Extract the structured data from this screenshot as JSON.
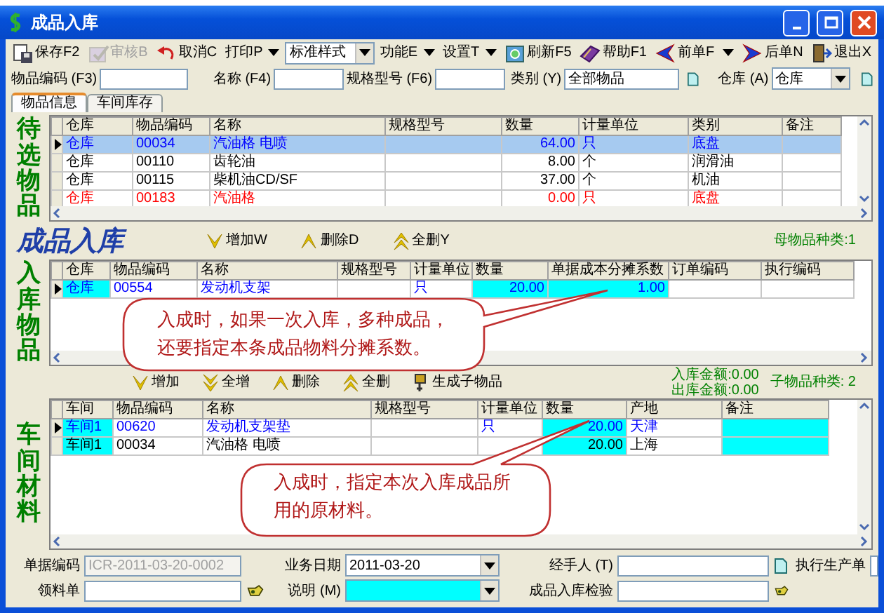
{
  "window": {
    "title": "成品入库"
  },
  "toolbar": [
    {
      "kind": "button",
      "label": "保存F2",
      "disabled": false
    },
    {
      "kind": "button",
      "label": "审核B",
      "disabled": true
    },
    {
      "kind": "button",
      "label": "取消C",
      "disabled": false
    },
    {
      "kind": "menu",
      "label": "打印P",
      "disabled": false
    },
    {
      "kind": "combo",
      "value": "标准样式",
      "disabled": false
    },
    {
      "kind": "menu",
      "label": "功能E",
      "disabled": false
    },
    {
      "kind": "menu",
      "label": "设置T",
      "disabled": false
    },
    {
      "kind": "button",
      "label": "刷新F5",
      "disabled": false
    },
    {
      "kind": "button",
      "label": "帮助F1",
      "disabled": false
    },
    {
      "kind": "button",
      "label": "前单F",
      "disabled": false
    },
    {
      "kind": "arrow",
      "disabled": false
    },
    {
      "kind": "button",
      "label": "后单N",
      "disabled": false
    },
    {
      "kind": "button",
      "label": "退出X",
      "disabled": false
    }
  ],
  "filters": [
    {
      "kind": "text",
      "label": "物品编码 (F3)"
    },
    {
      "kind": "text",
      "label": "名称 (F4)"
    },
    {
      "kind": "text",
      "label": "规格型号 (F6)"
    },
    {
      "kind": "picker",
      "label": "类别 (Y)",
      "value": "全部物品"
    },
    {
      "kind": "select",
      "label": "仓库 (A)",
      "value": "仓库"
    }
  ],
  "tabs": [
    {
      "label": "物品信息",
      "selected": true
    },
    {
      "label": "车间库存",
      "selected": false
    }
  ],
  "candidates": {
    "label": "待选物品",
    "columns": [
      {
        "title": "仓库",
        "highlighted": false
      },
      {
        "title": "物品编码",
        "highlighted": false
      },
      {
        "title": "名称",
        "highlighted": false
      },
      {
        "title": "规格型号",
        "highlighted": false
      },
      {
        "title": "数量",
        "highlighted": false
      },
      {
        "title": "计量单位",
        "highlighted": false
      },
      {
        "title": "类别",
        "highlighted": false
      },
      {
        "title": "备注",
        "highlighted": false
      }
    ],
    "rows": [
      {
        "cells": [
          "仓库",
          "00034",
          "汽油格 电喷",
          null,
          "64.00",
          "只",
          "底盘",
          null
        ],
        "selected": true,
        "current": true
      },
      {
        "cells": [
          "仓库",
          "00110",
          "齿轮油",
          null,
          "8.00",
          "个",
          "润滑油",
          null
        ],
        "color": "#000000",
        "selected": false,
        "current": false
      },
      {
        "cells": [
          "仓库",
          "00115",
          "柴机油CD/SF",
          null,
          "37.00",
          "个",
          "机油",
          null
        ],
        "color": "#000000",
        "selected": false,
        "current": false
      },
      {
        "cells": [
          "仓库",
          "00183",
          "汽油格",
          null,
          "0.00",
          "只",
          "底盘",
          null
        ],
        "color": "#ff0000",
        "selected": false,
        "current": false
      }
    ]
  },
  "product_bar": {
    "heading": "成品入库",
    "actions": [
      {
        "kind": "add",
        "label": "增加W"
      },
      {
        "kind": "delete",
        "label": "删除D"
      },
      {
        "kind": "delete-all",
        "label": "全删Y"
      }
    ],
    "count": "母物品种类:1"
  },
  "products": {
    "label": "入库物品",
    "columns": [
      {
        "title": "仓库",
        "highlighted": true
      },
      {
        "title": "物品编码",
        "highlighted": false
      },
      {
        "title": "名称",
        "highlighted": false
      },
      {
        "title": "规格型号",
        "highlighted": false
      },
      {
        "title": "计量单位",
        "highlighted": false
      },
      {
        "title": "数量",
        "highlighted": true
      },
      {
        "title": "单据成本分摊系数",
        "highlighted": true
      },
      {
        "title": "订单编码",
        "highlighted": false
      },
      {
        "title": "执行编码",
        "highlighted": false
      }
    ],
    "rows": [
      {
        "cells": [
          "仓库",
          "00554",
          "发动机支架",
          null,
          "只",
          "20.00",
          "1.00",
          null,
          null
        ],
        "color": "#0000ff",
        "current": true
      }
    ]
  },
  "material_bar": {
    "actions": [
      {
        "kind": "add",
        "label": "增加"
      },
      {
        "kind": "add-all",
        "label": "全增"
      },
      {
        "kind": "delete",
        "label": "删除"
      },
      {
        "kind": "delete-all",
        "label": "全删"
      },
      {
        "kind": "generate",
        "label": "生成子物品"
      }
    ],
    "totals": [
      "入库金额:0.00",
      "出库金额:0.00"
    ],
    "count": "子物品种类: 2"
  },
  "materials": {
    "label": "车间材料",
    "columns": [
      {
        "title": "车间",
        "highlighted": true
      },
      {
        "title": "物品编码",
        "highlighted": false
      },
      {
        "title": "名称",
        "highlighted": false
      },
      {
        "title": "规格型号",
        "highlighted": false
      },
      {
        "title": "计量单位",
        "highlighted": false
      },
      {
        "title": "数量",
        "highlighted": true
      },
      {
        "title": "产地",
        "highlighted": false
      },
      {
        "title": "备注",
        "highlighted": true
      }
    ],
    "rows": [
      {
        "cells": [
          "车间1",
          "00620",
          "发动机支架垫",
          null,
          "只",
          "20.00",
          "天津",
          null
        ],
        "color": "#0000ff",
        "current": true
      },
      {
        "cells": [
          "车间1",
          "00034",
          "汽油格 电喷",
          null,
          null,
          "20.00",
          "上海",
          null
        ],
        "color": "#000000",
        "current": false
      }
    ]
  },
  "callouts": [
    {
      "lines": [
        "入成时，如果一次入库，多种成品，",
        "还要指定本条成品物料分摊系数。"
      ]
    },
    {
      "lines": [
        "入成时，指定本次入库成品所",
        "用的原材料。"
      ]
    }
  ],
  "form": [
    [
      {
        "kind": "text",
        "label": "单据编码",
        "value": "ICR-2011-03-20-0002",
        "disabled": true
      },
      {
        "kind": "select",
        "label": "业务日期",
        "value": "2011-03-20",
        "disabled": false
      },
      {
        "kind": "picker",
        "label": "经手人 (T)",
        "disabled": false
      },
      {
        "kind": "text",
        "label": "执行生产单",
        "disabled": false
      }
    ],
    [
      {
        "kind": "lookup",
        "label": "领料单",
        "disabled": false
      },
      {
        "kind": "select",
        "label": "说明 (M)",
        "highlighted": true,
        "disabled": false
      },
      {
        "kind": "lookup",
        "label": "成品入库检验",
        "disabled": false
      }
    ]
  ]
}
